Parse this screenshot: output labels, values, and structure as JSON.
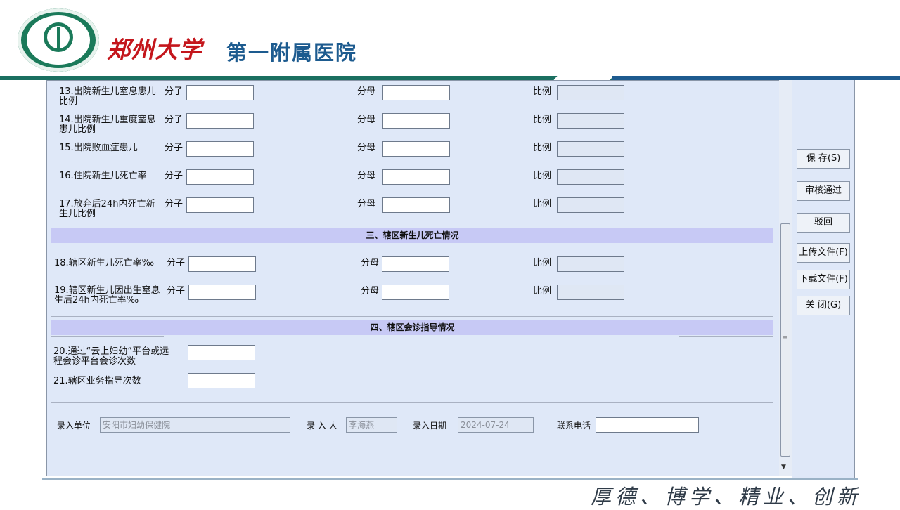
{
  "header": {
    "hospital_name_cal": "郑州大学",
    "hospital_name": "第一附属医院"
  },
  "rows": [
    {
      "label": "13.出院新生儿窒息患儿比例",
      "numerator": "分子",
      "denominator": "分母",
      "ratio": "比例"
    },
    {
      "label": "14.出院新生儿重度窒息患儿比例",
      "numerator": "分子",
      "denominator": "分母",
      "ratio": "比例"
    },
    {
      "label": "15.出院败血症患儿",
      "numerator": "分子",
      "denominator": "分母",
      "ratio": "比例"
    },
    {
      "label": "16.住院新生儿死亡率",
      "numerator": "分子",
      "denominator": "分母",
      "ratio": "比例"
    },
    {
      "label": "17.放弃后24h内死亡新生儿比例",
      "numerator": "分子",
      "denominator": "分母",
      "ratio": "比例"
    }
  ],
  "section3": {
    "title": "三、辖区新生儿死亡情况",
    "rows": [
      {
        "label": "18.辖区新生儿死亡率‰",
        "numerator": "分子",
        "denominator": "分母",
        "ratio": "比例"
      },
      {
        "label": "19.辖区新生儿因出生窒息生后24h内死亡率‰",
        "numerator": "分子",
        "denominator": "分母",
        "ratio": "比例"
      }
    ]
  },
  "section4": {
    "title": "四、辖区会诊指导情况",
    "rows": [
      {
        "label": "20.通过“云上妇幼”平台或远程会诊平台会诊次数"
      },
      {
        "label": "21.辖区业务指导次数"
      }
    ]
  },
  "footer": {
    "unit_label": "录入单位",
    "unit_value": "安阳市妇幼保健院",
    "person_label": "录 入 人",
    "person_value": "李海燕",
    "date_label": "录入日期",
    "date_value": "2024-07-24",
    "phone_label": "联系电话",
    "phone_value": ""
  },
  "buttons": {
    "save": "保 存(S)",
    "approve": "审核通过",
    "reject": "驳回",
    "upload": "上传文件(F)",
    "download": "下载文件(F)",
    "close": "关 闭(G)"
  },
  "motto": "厚德、博学、精业、创新"
}
